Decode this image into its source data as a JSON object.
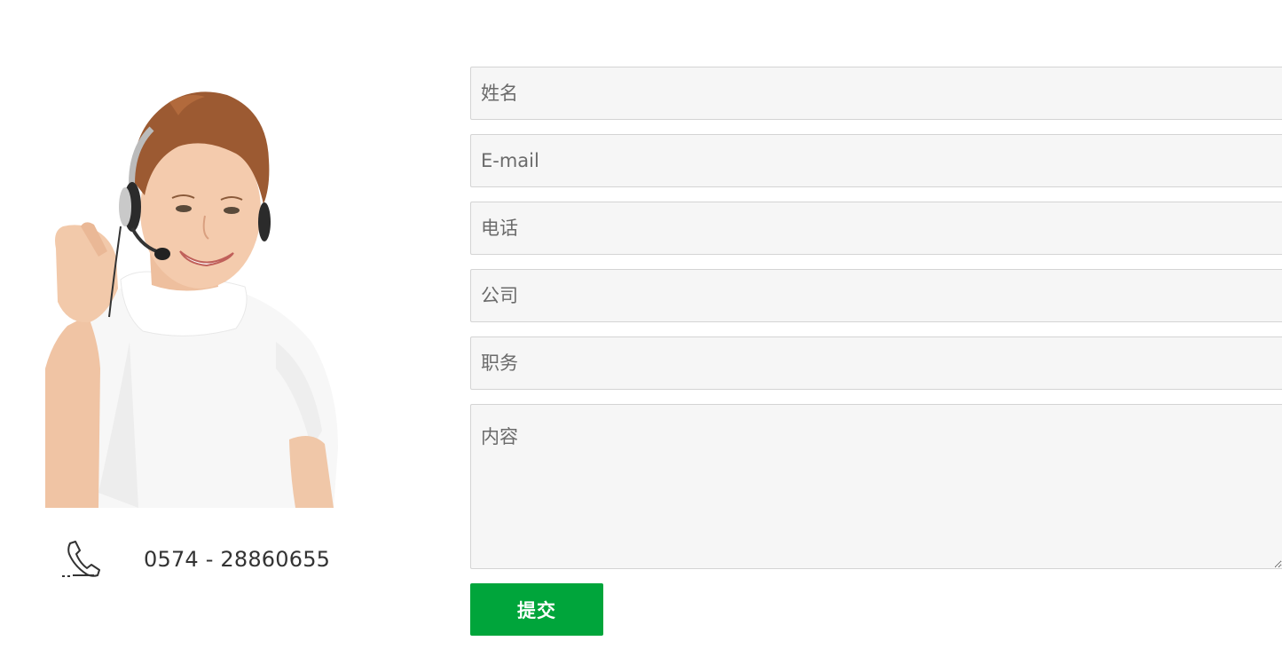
{
  "contact": {
    "phone": "0574 - 28860655"
  },
  "form": {
    "name_placeholder": "姓名",
    "email_placeholder": "E-mail",
    "phone_placeholder": "电话",
    "company_placeholder": "公司",
    "position_placeholder": "职务",
    "content_placeholder": "内容",
    "submit_label": "提交"
  },
  "icons": {
    "phone": "phone-icon"
  },
  "colors": {
    "submit_bg": "#00a53b",
    "field_bg": "#f6f6f6",
    "field_border": "#d4d4d4",
    "text": "#333333"
  }
}
